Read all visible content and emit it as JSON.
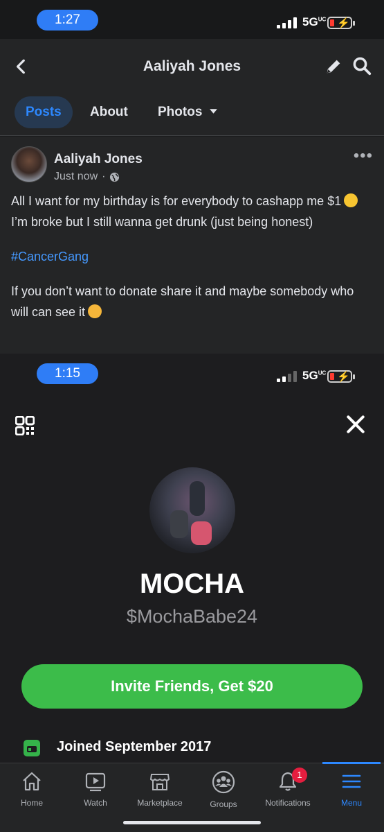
{
  "status_top": {
    "time": "1:27",
    "network": "5G",
    "network_sup": "UC"
  },
  "fb_header": {
    "title": "Aaliyah Jones",
    "back_icon": "chevron-left-icon",
    "edit_icon": "pencil-icon",
    "search_icon": "search-icon"
  },
  "tabs": [
    {
      "label": "Posts",
      "active": true
    },
    {
      "label": "About",
      "active": false
    },
    {
      "label": "Photos",
      "active": false,
      "icon": "caret-down-icon"
    }
  ],
  "post": {
    "author": "Aaliyah Jones",
    "time": "Just now",
    "privacy_icon": "globe-icon",
    "line1": "All I want for my birthday is for everybody to cashapp me $1",
    "line2": "I’m broke but I still wanna get drunk (just being honest)",
    "hashtag": "#CancerGang",
    "line3": "If you don’t want to donate share it and maybe somebody who will can see it",
    "emoji1": "star-struck-emoji",
    "emoji2": "smiling-face-with-hearts-emoji"
  },
  "status_bottom": {
    "time": "1:15",
    "network": "5G",
    "network_sup": "UC"
  },
  "cashapp": {
    "name": "MOCHA",
    "cashtag": "$MochaBabe24",
    "invite_label": "Invite Friends, Get $20",
    "joined": "Joined September 2017",
    "accent": "#3cbc4a"
  },
  "bottom_nav": [
    {
      "label": "Home",
      "icon": "home-icon"
    },
    {
      "label": "Watch",
      "icon": "watch-icon"
    },
    {
      "label": "Marketplace",
      "icon": "marketplace-icon"
    },
    {
      "label": "Groups",
      "icon": "groups-icon"
    },
    {
      "label": "Notifications",
      "icon": "bell-icon",
      "badge": "1"
    },
    {
      "label": "Menu",
      "icon": "menu-icon",
      "active": true
    }
  ],
  "colors": {
    "fb_blue": "#2d88ff",
    "link": "#4599ff",
    "badge": "#e41e3f"
  }
}
